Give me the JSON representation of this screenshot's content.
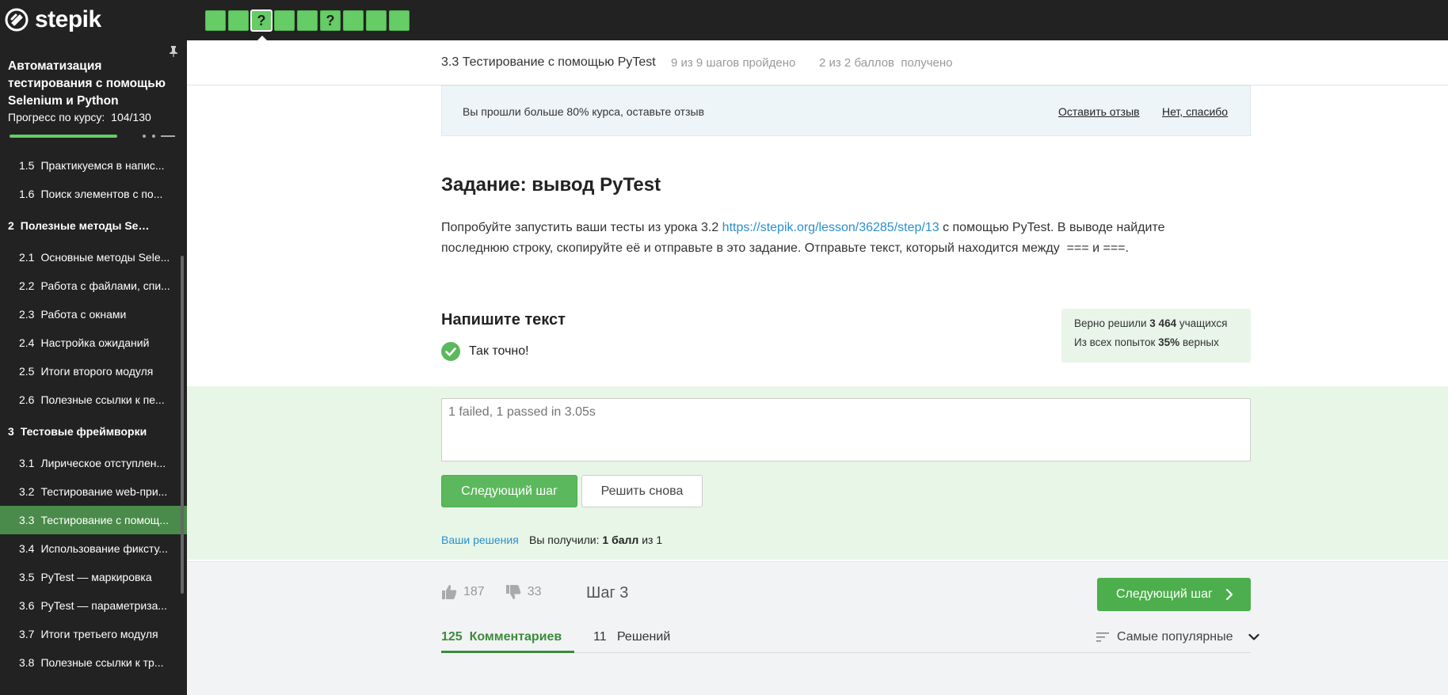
{
  "app": {
    "logo_text": "stepik"
  },
  "steps_bar": [
    {
      "mark": ""
    },
    {
      "mark": ""
    },
    {
      "mark": "?",
      "active": true
    },
    {
      "mark": ""
    },
    {
      "mark": ""
    },
    {
      "mark": "?"
    },
    {
      "mark": ""
    },
    {
      "mark": ""
    },
    {
      "mark": ""
    }
  ],
  "sidebar": {
    "course_title": "Автоматизация тестирования с помощью Selenium и Python",
    "progress_label": "Прогресс по курсу:",
    "progress_value": "104/130",
    "progress_fraction": 0.8,
    "items": [
      {
        "type": "lesson",
        "num": "1.5",
        "label": "Практикуемся в напис..."
      },
      {
        "type": "lesson",
        "num": "1.6",
        "label": "Поиск элементов с по..."
      },
      {
        "type": "module",
        "num": "2",
        "label": "Полезные методы Selen..."
      },
      {
        "type": "lesson",
        "num": "2.1",
        "label": "Основные методы Sele..."
      },
      {
        "type": "lesson",
        "num": "2.2",
        "label": "Работа с файлами, спи..."
      },
      {
        "type": "lesson",
        "num": "2.3",
        "label": "Работа с окнами"
      },
      {
        "type": "lesson",
        "num": "2.4",
        "label": "Настройка ожиданий"
      },
      {
        "type": "lesson",
        "num": "2.5",
        "label": "Итоги второго модуля"
      },
      {
        "type": "lesson",
        "num": "2.6",
        "label": "Полезные ссылки к пе..."
      },
      {
        "type": "module",
        "num": "3",
        "label": "Тестовые фреймворки"
      },
      {
        "type": "lesson",
        "num": "3.1",
        "label": "Лирическое отступлен..."
      },
      {
        "type": "lesson",
        "num": "3.2",
        "label": "Тестирование web-при..."
      },
      {
        "type": "lesson",
        "num": "3.3",
        "label": "Тестирование с помощ...",
        "active": true
      },
      {
        "type": "lesson",
        "num": "3.4",
        "label": "Использование фиксту..."
      },
      {
        "type": "lesson",
        "num": "3.5",
        "label": "PyTest — маркировка"
      },
      {
        "type": "lesson",
        "num": "3.6",
        "label": "PyTest — параметриза..."
      },
      {
        "type": "lesson",
        "num": "3.7",
        "label": "Итоги третьего модуля"
      },
      {
        "type": "lesson",
        "num": "3.8",
        "label": "Полезные ссылки к тр..."
      }
    ]
  },
  "step_header": {
    "lesson": "3.3 Тестирование с помощью PyTest",
    "steps_done": "9 из 9 шагов пройдено",
    "points": "2 из 2 баллов  получено"
  },
  "review_banner": {
    "text": "Вы прошли больше 80% курса, оставьте отзыв",
    "leave_review": "Оставить отзыв",
    "no_thanks": "Нет, спасибо"
  },
  "task": {
    "title": "Задание: вывод PyTest",
    "desc_before": "Попробуйте запустить ваши тесты из урока 3.2 ",
    "link": "https://stepik.org/lesson/36285/step/13",
    "desc_after": " с помощью PyTest. В выводе найдите последнюю строку, скопируйте её и отправьте в это задание. Отправьте текст, который находится между  === и ===."
  },
  "quiz": {
    "title": "Напишите текст",
    "result": "Так точно!",
    "stats": {
      "solved_prefix": "Верно решили ",
      "solved_count": "3 464",
      "solved_suffix": " учащихся",
      "attempts_prefix": "Из всех попыток ",
      "attempts_pct": "35%",
      "attempts_suffix": " верных"
    },
    "answer_placeholder": "1 failed, 1 passed in 3.05s",
    "next_button": "Следующий шаг",
    "retry_button": "Решить снова",
    "solutions_link": "Ваши решения",
    "score_prefix": "Вы получили: ",
    "score_value": "1 балл",
    "score_suffix": " из 1"
  },
  "footer": {
    "likes": "187",
    "dislikes": "33",
    "step_label": "Шаг 3",
    "next_step_button": "Следующий шаг",
    "tabs": {
      "comments_count": "125",
      "comments_label": "Комментариев",
      "solutions_count": "11",
      "solutions_label": "Решений"
    },
    "sort_label": "Самые популярные"
  },
  "colors": {
    "accent_green": "#5cb85c",
    "sidebar_bg": "#222222",
    "link_blue": "#2a8fcf"
  }
}
